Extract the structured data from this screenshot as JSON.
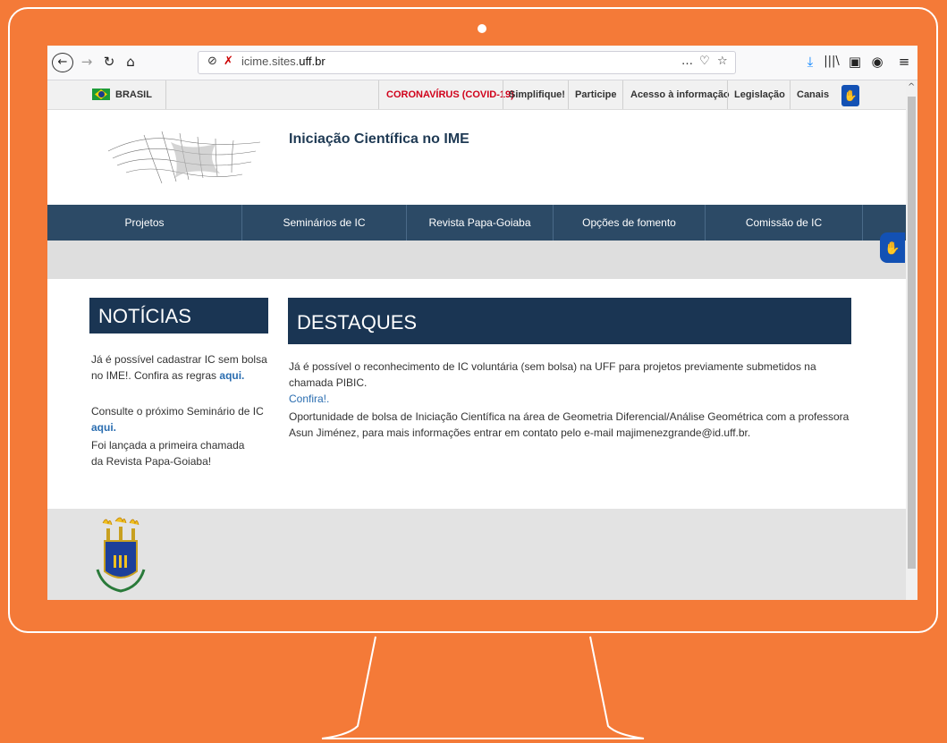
{
  "browser": {
    "url_prefix": "icime.sites.",
    "url_domain": "uff.br",
    "menu_dots": "…"
  },
  "govbar": {
    "country": "BRASIL",
    "links": [
      "CORONAVÍRUS (COVID-19)",
      "Simplifique!",
      "Participe",
      "Acesso à informação",
      "Legislação",
      "Canais"
    ]
  },
  "site": {
    "title": "Iniciação Científica no IME"
  },
  "nav": {
    "items": [
      "Projetos",
      "Seminários de IC",
      "Revista Papa-Goiaba",
      "Opções de fomento",
      "Comissão de IC"
    ]
  },
  "noticias": {
    "title": "NOTÍCIAS",
    "item1_text": "Já é possível cadastrar IC sem bolsa no IME!. Confira as regras ",
    "item1_link": "aqui.",
    "item2_text": "Consulte o próximo Seminário de IC ",
    "item2_link": "aqui.",
    "item3_text": "Foi lançada a primeira chamada da Revista Papa-Goiaba!"
  },
  "destaques": {
    "title": "DESTAQUES",
    "item1_text": "Já é possível o reconhecimento de IC voluntária (sem bolsa) na UFF para projetos previamente submetidos na chamada PIBIC.",
    "item1_link": "Confira!.",
    "item2_text": "Oportunidade de bolsa de Iniciação Científica na área de Geometria Diferencial/Análise Geométrica com a professora Asun Jiménez, para mais informações entrar em contato pelo e-mail majimenezgrande@id.uff.br."
  },
  "icons": [
    "back-icon",
    "forward-icon",
    "reload-icon",
    "home-icon",
    "tracking-shield-icon",
    "insecure-lock-icon",
    "page-actions-icon",
    "pocket-icon",
    "bookmark-star-icon",
    "download-icon",
    "library-icon",
    "sidebar-icon",
    "account-icon",
    "hamburger-menu-icon",
    "accessibility-hand-icon",
    "vlibras-icon"
  ],
  "colors": {
    "background": "#f47a38",
    "nav": "#2c4a66",
    "headers": "#1a3553",
    "covid": "#d0021b",
    "link": "#2a6db0"
  }
}
